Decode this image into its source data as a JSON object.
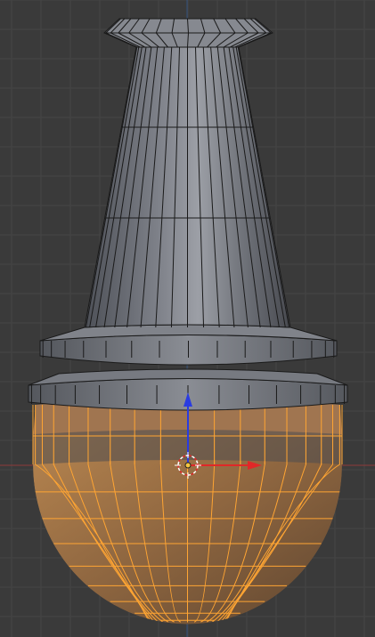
{
  "viewport": {
    "editor": "3d-viewport",
    "mode": "edit-mode",
    "background_color": "#3a3a3a",
    "grid_color": "#444444",
    "axis_x_color": "#9b3a3a",
    "axis_z_color": "#2f5fa8"
  },
  "mesh": {
    "unselected_face_color": "#8d9097",
    "unselected_edge_color": "#1a1a1a",
    "selected_face_color": "#b07a45",
    "selected_edge_color": "#ffa533",
    "parts": [
      "top-cap",
      "tapered-shaft",
      "upper-ring",
      "lower-ring",
      "sphere-band",
      "sphere-bottom"
    ]
  },
  "gizmo": {
    "type": "translate",
    "x_arrow_color": "#e02828",
    "z_arrow_color": "#2a3ce0",
    "cursor_icon": "3d-cursor-icon"
  }
}
